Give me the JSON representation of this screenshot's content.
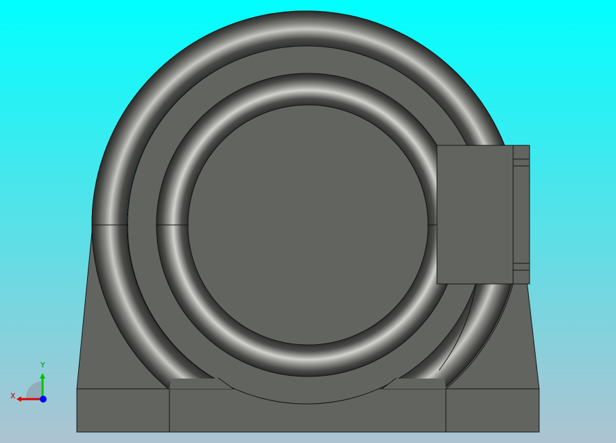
{
  "viewport": {
    "background_top_color": "#00ffff",
    "background_bottom_color": "#aec3d1",
    "model_fill_color": "#626460",
    "edge_color": "#141414"
  },
  "triad": {
    "y_label": "Y",
    "x_label": "X",
    "x_axis_color": "#e00000",
    "y_axis_color": "#00c000",
    "z_axis_color": "#0000ff"
  }
}
